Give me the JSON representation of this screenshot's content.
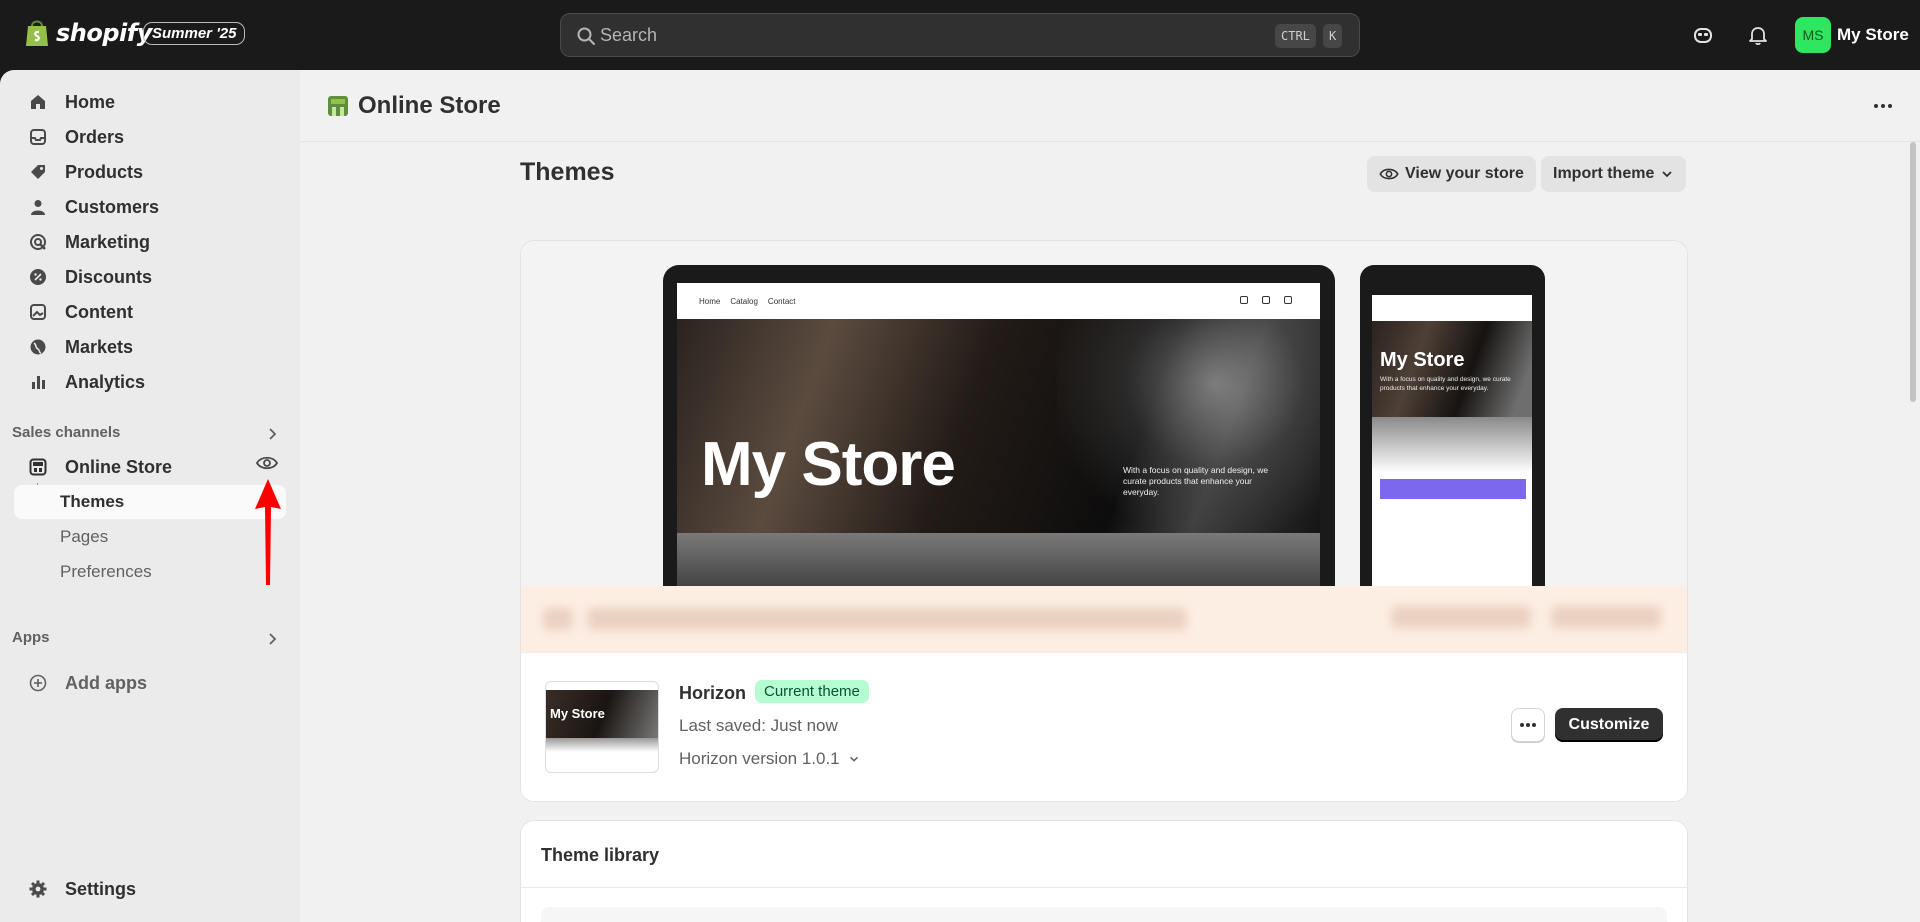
{
  "topbar": {
    "brand": "shopify",
    "edition_badge": "Summer '25",
    "search_placeholder": "Search",
    "shortcut_ctrl": "CTRL",
    "shortcut_k": "K",
    "avatar_initials": "MS",
    "store_name": "My Store"
  },
  "sidebar": {
    "items": [
      {
        "label": "Home",
        "icon": "home-icon"
      },
      {
        "label": "Orders",
        "icon": "inbox-icon"
      },
      {
        "label": "Products",
        "icon": "tag-icon"
      },
      {
        "label": "Customers",
        "icon": "person-icon"
      },
      {
        "label": "Marketing",
        "icon": "target-icon"
      },
      {
        "label": "Discounts",
        "icon": "discount-icon"
      },
      {
        "label": "Content",
        "icon": "image-icon"
      },
      {
        "label": "Markets",
        "icon": "globe-icon"
      },
      {
        "label": "Analytics",
        "icon": "bar-chart-icon"
      }
    ],
    "sales_channels_title": "Sales channels",
    "online_store": "Online Store",
    "sub_items": [
      "Themes",
      "Pages",
      "Preferences"
    ],
    "apps_title": "Apps",
    "add_apps": "Add apps",
    "settings": "Settings"
  },
  "main": {
    "page_title": "Online Store",
    "section_title": "Themes",
    "view_store": "View your store",
    "import_theme": "Import theme",
    "preview": {
      "nav_links": [
        "Home",
        "Catalog",
        "Contact"
      ],
      "hero_title": "My Store",
      "hero_subtitle": "With a focus on quality and design, we curate products that enhance your everyday.",
      "phone_title": "My Store",
      "phone_subtitle": "With a focus on quality and design, we curate products that enhance your everyday."
    },
    "theme": {
      "name": "Horizon",
      "status_badge": "Current theme",
      "last_saved": "Last saved: Just now",
      "version": "Horizon version 1.0.1",
      "thumb_title": "My Store",
      "customize": "Customize"
    },
    "library_title": "Theme library"
  },
  "colors": {
    "topbar_bg": "#1a1a1a",
    "avatar_bg": "#2ee65f",
    "badge_bg": "#b4fed2",
    "primary_button": "#303030",
    "annotation_arrow": "#ff0000"
  }
}
